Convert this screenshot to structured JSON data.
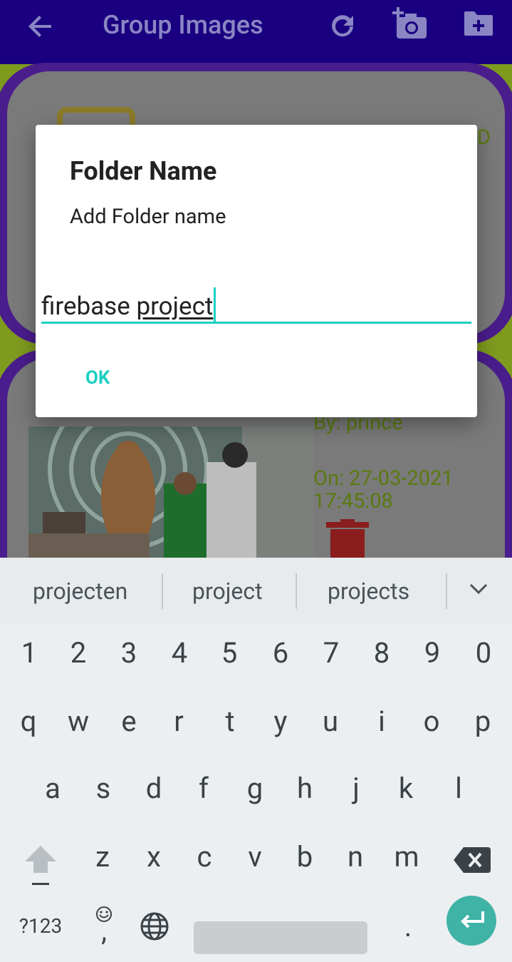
{
  "app_bar": {
    "title": "Group Images",
    "back_icon": "arrow-back-icon",
    "refresh_icon": "refresh-icon",
    "add_photo_icon": "add-photo-icon",
    "create_folder_icon": "create-folder-icon"
  },
  "background": {
    "card1_side_text": "D",
    "card2_by": "By: prince",
    "card2_on_date": "On: 27-03-2021",
    "card2_on_time": "17:45:08",
    "delete_icon": "trash-icon"
  },
  "dialog": {
    "title": "Folder Name",
    "message": "Add Folder name",
    "input_value_plain": "firebase ",
    "input_value_composing": "project",
    "ok_label": "OK"
  },
  "keyboard": {
    "suggestions": [
      "projecten",
      "project",
      "projects"
    ],
    "number_row": [
      "1",
      "2",
      "3",
      "4",
      "5",
      "6",
      "7",
      "8",
      "9",
      "0"
    ],
    "row1": [
      "q",
      "w",
      "e",
      "r",
      "t",
      "y",
      "u",
      "i",
      "o",
      "p"
    ],
    "row2": [
      "a",
      "s",
      "d",
      "f",
      "g",
      "h",
      "j",
      "k",
      "l"
    ],
    "row3": [
      "z",
      "x",
      "c",
      "v",
      "b",
      "n",
      "m"
    ],
    "symbols_label": "?123",
    "comma_label": ",",
    "period_label": "."
  },
  "colors": {
    "app_bar": "#1a0080",
    "accent": "#1ccfc2",
    "card_border": "#4a1d8d",
    "enter_key": "#3fb3a5"
  }
}
